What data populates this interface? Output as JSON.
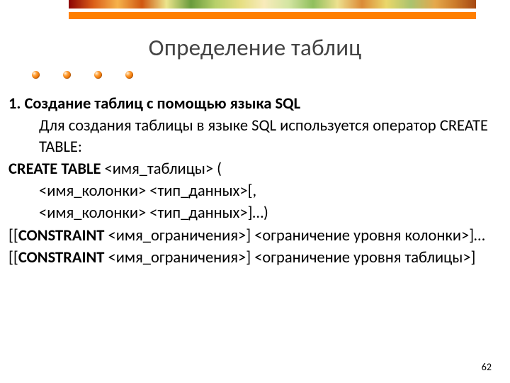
{
  "title": "Определение таблиц",
  "section": {
    "number": "1.",
    "heading": "Создание таблиц с помощью языка SQL",
    "intro": "Для создания таблицы в языке SQL используется оператор CREATE TABLE:"
  },
  "syntax": {
    "keyword_create": "CREATE TABLE",
    "line_create_tail": " <имя_таблицы> (",
    "line_col1": "<имя_колонки> <тип_данных>[,",
    "line_col2": "<имя_колонки> <тип_данных>]…)",
    "keyword_constraint": "CONSTRAINT",
    "line_constraint1_head": "[[",
    "line_constraint1_tail": " <имя_ограничения>] <ограничение уровня колонки>]…",
    "line_constraint2_head": "[[",
    "line_constraint2_tail": " <имя_ограничения>] <ограничение уровня таблицы>]"
  },
  "page_number": "62"
}
